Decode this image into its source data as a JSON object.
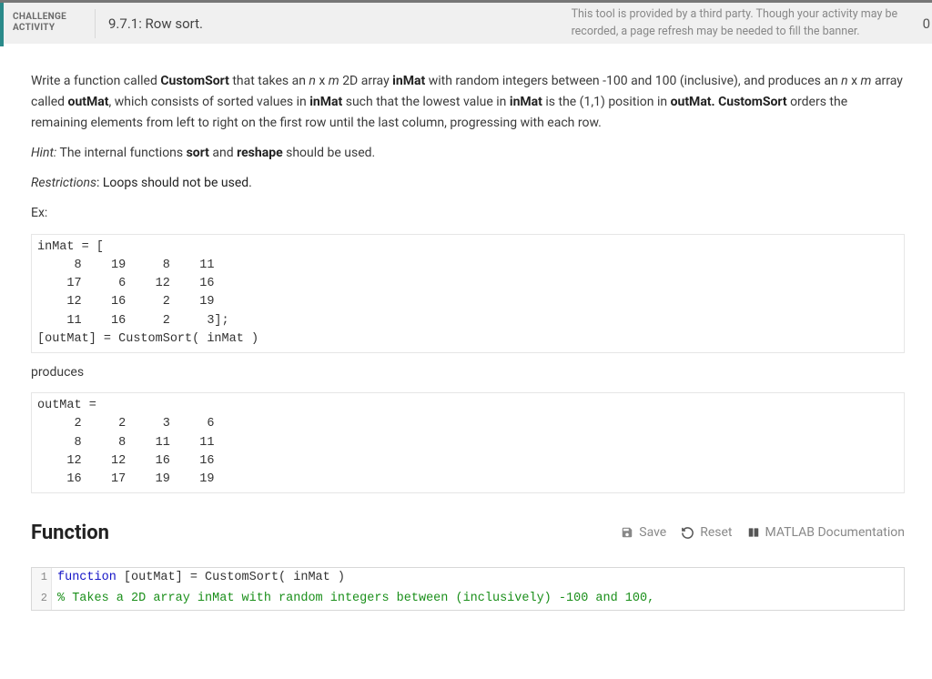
{
  "header": {
    "badge_line1": "CHALLENGE",
    "badge_line2": "ACTIVITY",
    "activity_number_title": "9.7.1: Row sort.",
    "third_party_notice": "This tool is provided by a third party. Though your activity may be recorded, a page refresh may be needed to fill the banner.",
    "score_fragment": "0"
  },
  "problem": {
    "p1_pre": "Write a function called ",
    "p1_b1": "CustomSort",
    "p1_mid1": " that takes an ",
    "p1_i1": "n",
    "p1_x1": " x ",
    "p1_i2": "m",
    "p1_mid2": " 2D array ",
    "p1_b2": "inMat",
    "p1_mid3": " with random integers between -100 and 100 (inclusive), and produces an ",
    "p1_i3": "n",
    "p1_x2": " x ",
    "p1_i4": "m",
    "p1_mid4": " array called ",
    "p1_b3": "outMat",
    "p1_mid5": ", which consists of sorted values in ",
    "p1_b4": "inMat",
    "p1_mid6": " such that the lowest value in ",
    "p1_b5": "inMat",
    "p1_mid7": " is the (1,1) position in ",
    "p1_b6": "outMat. CustomSort",
    "p1_end": " orders the remaining elements from left to right on the first row until the last column, progressing with each row.",
    "hint_label": "Hint:",
    "hint_pre": "  The internal functions ",
    "hint_b1": "sort",
    "hint_mid": " and ",
    "hint_b2": "reshape",
    "hint_end": " should be used.",
    "restrict_label": "Restrictions",
    "restrict_colon_text": ": Loops should not be used.",
    "ex_label": "Ex:"
  },
  "example": {
    "inmat_block": "inMat = [\n     8    19     8    11\n    17     6    12    16\n    12    16     2    19\n    11    16     2     3];\n[outMat] = CustomSort( inMat )",
    "produces_label": "produces",
    "outmat_block": "outMat =\n     2     2     3     6\n     8     8    11    11\n    12    12    16    16\n    16    17    19    19"
  },
  "function_section": {
    "heading": "Function",
    "save_label": "Save",
    "reset_label": "Reset",
    "doc_label": "MATLAB Documentation"
  },
  "code_editor": {
    "lines": [
      {
        "n": "1",
        "kw": "function",
        "rest": " [outMat] = CustomSort( inMat )"
      },
      {
        "n": "2",
        "comment": "% Takes a 2D array inMat with random integers between (inclusively) -100 and 100,"
      }
    ]
  }
}
